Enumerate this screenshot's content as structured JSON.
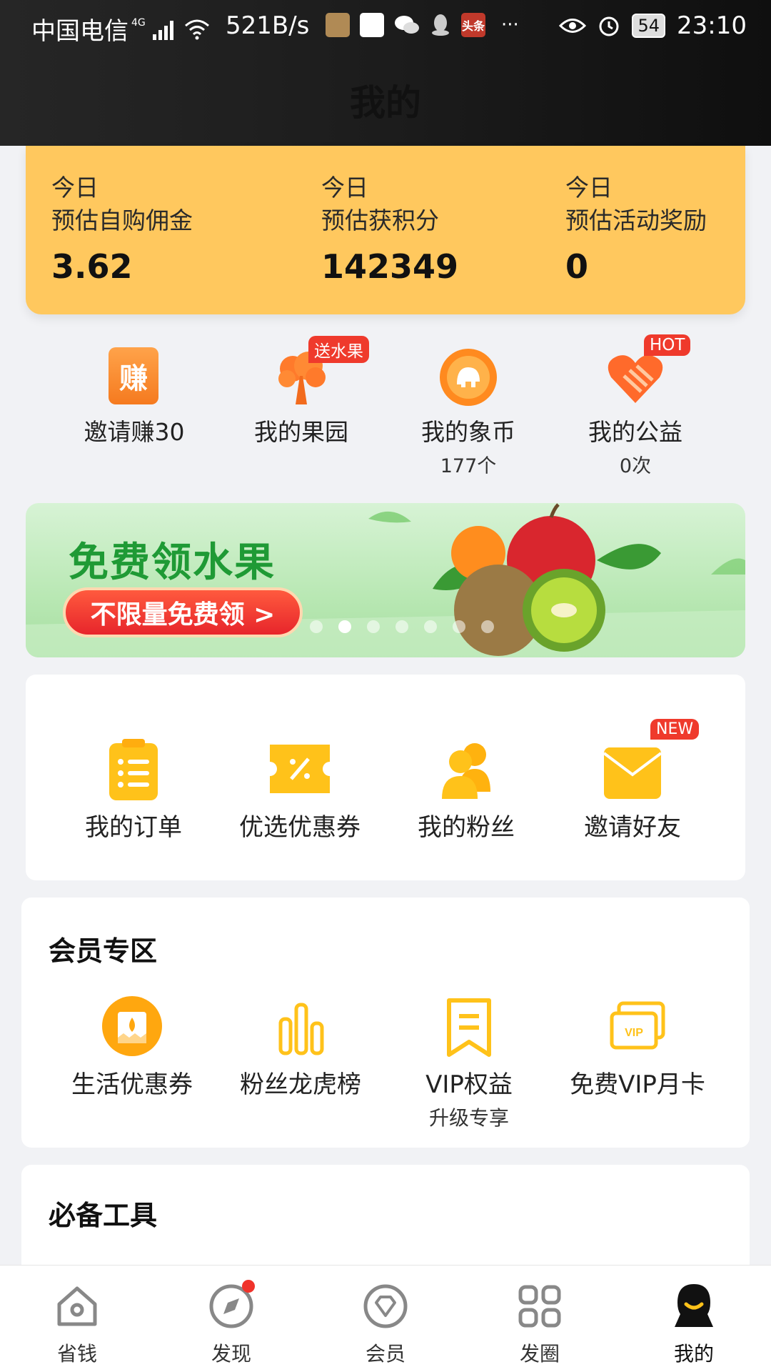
{
  "status_bar": {
    "carrier": "中国电信",
    "network": "4G",
    "speed": "521B/s",
    "more": "···",
    "battery": "54",
    "time": "23:10",
    "app_badge": "头条"
  },
  "header": {
    "title": "我的"
  },
  "earnings": {
    "items": [
      {
        "line1": "今日",
        "line2": "预估自购佣金",
        "value": "3.62"
      },
      {
        "line1": "今日",
        "line2": "预估获积分",
        "value": "142349"
      },
      {
        "line1": "今日",
        "line2": "预估活动奖励",
        "value": "0"
      }
    ]
  },
  "quick_links": {
    "items": [
      {
        "label": "邀请赚30",
        "icon": "earn-icon",
        "icon_text": "赚"
      },
      {
        "label": "我的果园",
        "tag": "送水果",
        "icon": "tree-icon"
      },
      {
        "label": "我的象币",
        "sub": "177个",
        "icon": "elephant-coin-icon"
      },
      {
        "label": "我的公益",
        "sub": "0次",
        "tag": "HOT",
        "icon": "heart-icon"
      }
    ]
  },
  "banner": {
    "title": "免费领水果",
    "button": "不限量免费领 >",
    "slides": 7,
    "active_slide": 2
  },
  "main_grid": {
    "items": [
      {
        "label": "我的订单",
        "icon": "order-clipboard-icon"
      },
      {
        "label": "优选优惠券",
        "icon": "coupon-icon"
      },
      {
        "label": "我的粉丝",
        "icon": "fans-icon"
      },
      {
        "label": "邀请好友",
        "tag": "NEW",
        "icon": "invite-envelope-icon"
      }
    ]
  },
  "member_zone": {
    "title": "会员专区",
    "items": [
      {
        "label": "生活优惠券",
        "icon": "life-coupon-icon"
      },
      {
        "label": "粉丝龙虎榜",
        "icon": "ranking-bars-icon"
      },
      {
        "label": "VIP权益",
        "sub": "升级专享",
        "icon": "vip-bookmark-icon"
      },
      {
        "label": "免费VIP月卡",
        "icon": "vip-card-icon",
        "icon_text": "VIP"
      }
    ]
  },
  "tools": {
    "title": "必备工具"
  },
  "tab_bar": {
    "items": [
      {
        "label": "省钱",
        "icon": "home-icon"
      },
      {
        "label": "发现",
        "icon": "compass-icon"
      },
      {
        "label": "会员",
        "icon": "diamond-icon"
      },
      {
        "label": "发圈",
        "icon": "grid-icon"
      },
      {
        "label": "我的",
        "icon": "profile-icon",
        "active": true
      }
    ]
  },
  "colors": {
    "accent": "#ffc85e",
    "icon_yellow": "#ffc21a",
    "tag_red": "#ef3a2c",
    "banner_green": "#1f9a35"
  }
}
